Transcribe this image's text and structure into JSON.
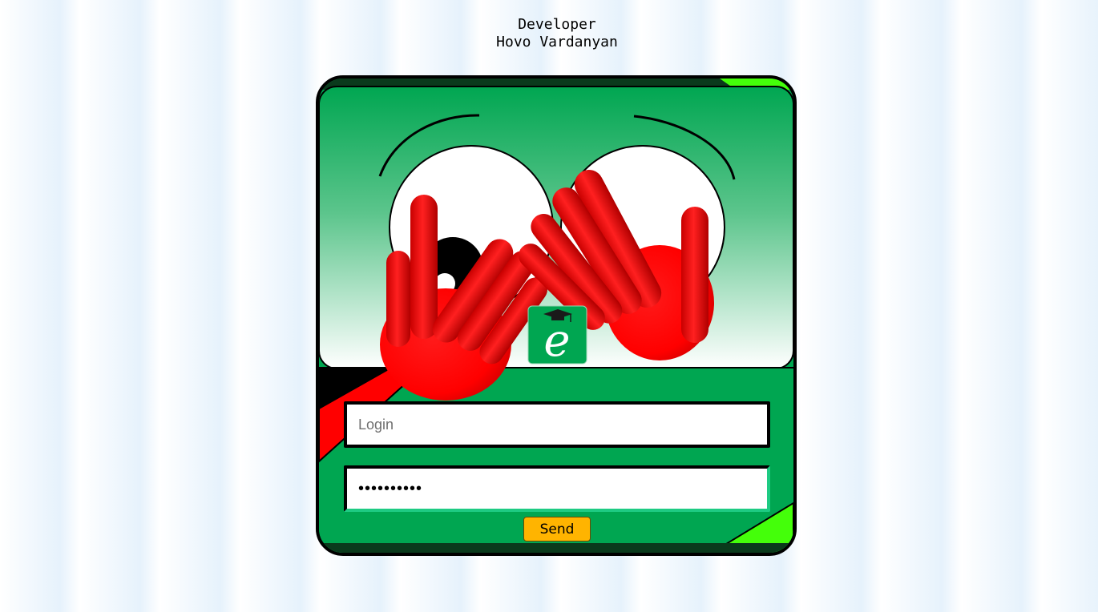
{
  "header": {
    "role": "Developer",
    "name": "Hovo Vardanyan"
  },
  "logo": {
    "letter": "e",
    "icon": "graduation-cap-icon"
  },
  "form": {
    "login_placeholder": "Login",
    "password_value": "••••••••••",
    "send_label": "Send"
  },
  "colors": {
    "card_green": "#00a651",
    "hand_red": "#ff0000",
    "corner_lime": "#44ff0a",
    "button_orange": "#ffb400",
    "input_focus_border": "#1ecb83"
  }
}
